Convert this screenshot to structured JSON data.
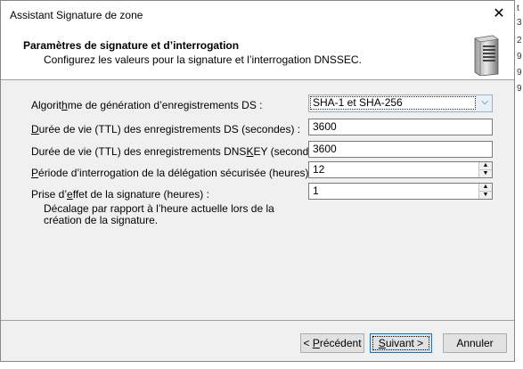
{
  "dialog": {
    "title": "Assistant Signature de zone",
    "close_glyph": "✕"
  },
  "header": {
    "title": "Paramètres de signature et d’interrogation",
    "subtitle": "Configurez les valeurs pour la signature et l’interrogation DNSSEC.",
    "icon": "server-icon"
  },
  "form": {
    "ds_algorithm": {
      "label_pre": "Algorit",
      "label_access": "h",
      "label_post": "me de génération d’enregistrements DS :",
      "value": "SHA-1 et SHA-256"
    },
    "ds_ttl": {
      "label_pre": "",
      "label_access": "D",
      "label_post": "urée de vie (TTL) des enregistrements DS (secondes) :",
      "value": "3600"
    },
    "dnskey_ttl": {
      "label_pre": "Durée de vie (TTL) des enregistrements DNS",
      "label_access": "K",
      "label_post": "EY (secondes) :",
      "value": "3600"
    },
    "delegation_poll": {
      "label_pre": "",
      "label_access": "P",
      "label_post": "ériode d’interrogation de la délégation sécurisée (heures) :",
      "value": "12"
    },
    "signature_inception": {
      "label_pre": "Prise d’",
      "label_access": "e",
      "label_post": "ffet de la signature (heures) :",
      "value": "1",
      "description": "Décalage par rapport à l’heure actuelle lors de la création de la signature."
    }
  },
  "buttons": {
    "back": {
      "pre": "< ",
      "access": "P",
      "post": "récédent"
    },
    "next": {
      "pre": "",
      "access": "S",
      "post": "uivant >"
    },
    "cancel": "Annuler"
  },
  "background_fragments": [
    "t",
    "3",
    "2",
    "9",
    "9",
    "9"
  ]
}
